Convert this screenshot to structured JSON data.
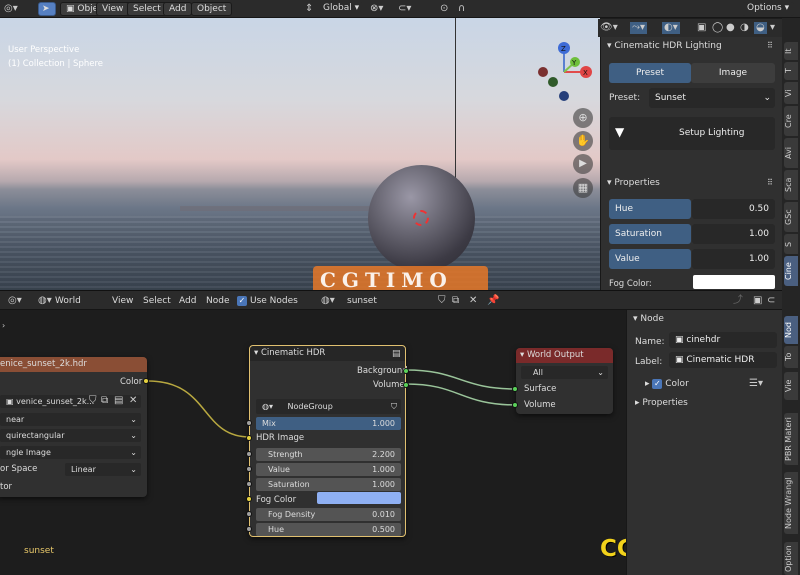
{
  "header": {
    "mode": "Object Mode",
    "menus": [
      "View",
      "Select",
      "Add",
      "Object"
    ],
    "orientation": "Global",
    "options": "Options"
  },
  "viewport": {
    "perspective": "User Perspective",
    "collection": "(1) Collection | Sphere",
    "gizmo": {
      "x": "X",
      "y": "Y",
      "z": "Z"
    }
  },
  "watermark_center": "CGTIMO",
  "watermark_corner": "CGtimo.com",
  "panel": {
    "title": "Cinematic HDR Lighting",
    "tabs": [
      "Preset",
      "Image"
    ],
    "preset_label": "Preset:",
    "preset_value": "Sunset",
    "setup_button": "Setup Lighting",
    "properties_title": "Properties",
    "hue": {
      "label": "Hue",
      "value": "0.50"
    },
    "saturation": {
      "label": "Saturation",
      "value": "1.00"
    },
    "value": {
      "label": "Value",
      "value": "1.00"
    },
    "fog_color_label": "Fog Color:",
    "vtabs": [
      "It",
      "T",
      "Vi",
      "Cre",
      "Avi",
      "Sca",
      "GSc",
      "S",
      "Cine"
    ]
  },
  "node_header": {
    "world": "World",
    "menus": [
      "View",
      "Select",
      "Add",
      "Node"
    ],
    "use_nodes": "Use Nodes",
    "name": "sunset"
  },
  "env_node": {
    "title": "enice_sunset_2k.hdr",
    "output": "Color",
    "image": "venice_sunset_2k...",
    "interp": "near",
    "proj": "quirectangular",
    "ext": "ngle Image",
    "color_space_label": "or Space",
    "color_space": "Linear",
    "vector": "tor"
  },
  "cine_node": {
    "title": "Cinematic HDR",
    "outputs": [
      "Background",
      "Volume"
    ],
    "group": "NodeGroup",
    "mix": {
      "label": "Mix",
      "value": "1.000"
    },
    "hdr_image": "HDR Image",
    "strength": {
      "label": "Strength",
      "value": "2.200"
    },
    "value": {
      "label": "Value",
      "value": "1.000"
    },
    "saturation": {
      "label": "Saturation",
      "value": "1.000"
    },
    "fog_color": "Fog Color",
    "fog_density": {
      "label": "Fog Density",
      "value": "0.010"
    },
    "hue": {
      "label": "Hue",
      "value": "0.500"
    }
  },
  "world_node": {
    "title": "World Output",
    "target": "All",
    "inputs": [
      "Surface",
      "Volume"
    ]
  },
  "sidebar": {
    "section": "Node",
    "name_label": "Name:",
    "name_value": "cinehdr",
    "label_label": "Label:",
    "label_value": "Cinematic HDR",
    "color": "Color",
    "properties": "Properties",
    "vtabs": [
      "Nod",
      "To",
      "Vie",
      "PBR Materi",
      "Node Wrangl",
      "Option"
    ]
  },
  "bottom_label": "sunset",
  "colors": {
    "accent": "#3f5f83",
    "fog": "#8fb0f3",
    "node_env": "#8a4e35",
    "node_world": "#7a2a2a",
    "socket_yellow": "#e6d23f",
    "socket_green": "#5ad15a",
    "socket_gray": "#a0a0a0"
  }
}
